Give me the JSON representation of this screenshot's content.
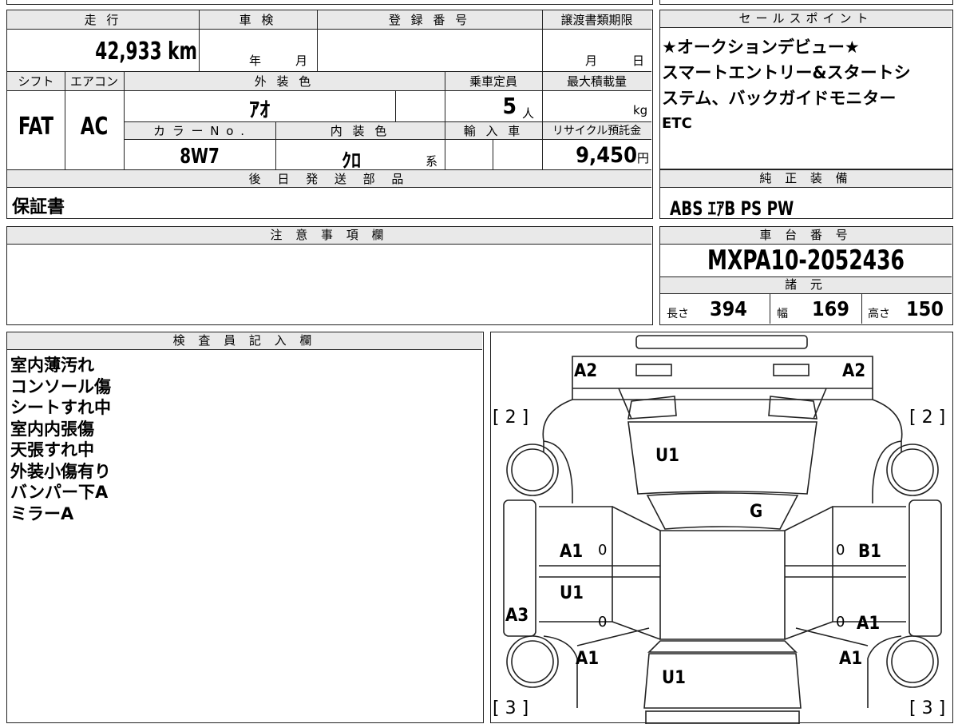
{
  "header": {
    "mileage_label": "走 行",
    "inspection_label": "車 検",
    "registration_label": "登 録 番 号",
    "transfer_deadline_label": "譲渡書類期限",
    "salespoint_label": "セールスポイント",
    "shift_label": "シフト",
    "aircon_label": "エアコン",
    "exterior_color_label": "外 装 色",
    "capacity_label": "乗車定員",
    "max_load_label": "最大積載量",
    "color_no_label": "カ ラ ー N o .",
    "interior_color_label": "内 装 色",
    "import_label": "輸 入 車",
    "recycle_label": "リサイクル預託金",
    "later_parts_label": "後 日 発 送 部 品",
    "genuine_equipment_label": "純 正 装 備",
    "notes_label": "注 意 事 項 欄",
    "chassis_label": "車 台 番 号",
    "specs_label": "諸 元",
    "inspector_label": "検 査 員 記 入 欄"
  },
  "vehicle": {
    "mileage": "42,933",
    "mileage_unit": "km",
    "inspection_year_unit": "年",
    "inspection_month_unit": "月",
    "deadline_month_unit": "月",
    "deadline_day_unit": "日",
    "shift": "FAT",
    "aircon": "AC",
    "exterior_color": "ｱｵ",
    "capacity": "5",
    "capacity_unit": "人",
    "max_load_unit": "kg",
    "color_no": "8W7",
    "interior_color": "ｸﾛ",
    "interior_suffix": "系",
    "recycle_fee": "9,450",
    "recycle_unit": "円",
    "later_parts": "保証書",
    "chassis_no": "MXPA10-2052436",
    "length_label": "長さ",
    "length": "394",
    "width_label": "幅",
    "width": "169",
    "height_label": "高さ",
    "height": "150"
  },
  "sales_points": [
    "★オークションデビュー★",
    "スマートエントリー&スタートシ",
    "ステム、バックガイドモニター",
    "ETC"
  ],
  "genuine_equipment": "ABS ｴｱB PS PW",
  "inspector_remarks": [
    "室内薄汚れ",
    "コンソール傷",
    "シートすれ中",
    "室内内張傷",
    "天張すれ中",
    "外装小傷有り",
    "バンパー下A",
    "ミラーA"
  ],
  "diagram": {
    "marks": {
      "top_left": "A2",
      "top_right": "A2",
      "hood": "U1",
      "windshield": "G",
      "left_front_door": "A1",
      "right_front_door": "B1",
      "left_rear_door": "U1",
      "left_rocker": "A3",
      "right_rear_door": "A1",
      "left_rear_fender": "A1",
      "right_rear_fender": "A1",
      "roof_rear": "U1"
    },
    "door_zero": "0",
    "tire_front_left": "[ 2 ]",
    "tire_front_right": "[ 2 ]",
    "tire_rear_left": "[ 3 ]",
    "tire_rear_right": "[ 3 ]"
  }
}
